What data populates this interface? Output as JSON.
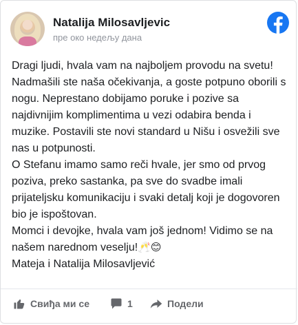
{
  "post": {
    "author_name": "Natalija Milosavljevic",
    "timestamp": "пре око недељу дана",
    "paragraphs": [
      "Dragi ljudi, hvala vam na najboljem provodu na svetu! Nadmašili ste naša očekivanja, a goste potpuno oborili s nogu. Neprestano dobijamo poruke i pozive sa najdivnijim komplimentima u vezi odabira benda i muzike. Postavili ste novi standard u Nišu i osvežili sve nas u potpunosti.",
      "O Stefanu imamo samo reči hvale, jer smo od prvog poziva, preko sastanka, pa sve do svadbe imali prijateljsku komunikaciju i svaki detalj koji je dogovoren bio je ispoštovan.",
      "Momci i devojke, hvala vam još jednom! Vidimo se na našem narednom veselju!",
      "Mateja i Natalija Milosavljević"
    ],
    "emojis": [
      "🥂",
      "😊"
    ]
  },
  "actions": {
    "like_label": "Свиђа ми се",
    "comment_count": "1",
    "share_label": "Подели"
  },
  "icons": {
    "brand": "facebook-icon",
    "like": "thumbs-up-icon",
    "comment": "comment-icon",
    "share": "share-arrow-icon"
  },
  "colors": {
    "facebook_blue": "#1877f2",
    "text": "#1c1e21",
    "muted": "#65676b"
  }
}
